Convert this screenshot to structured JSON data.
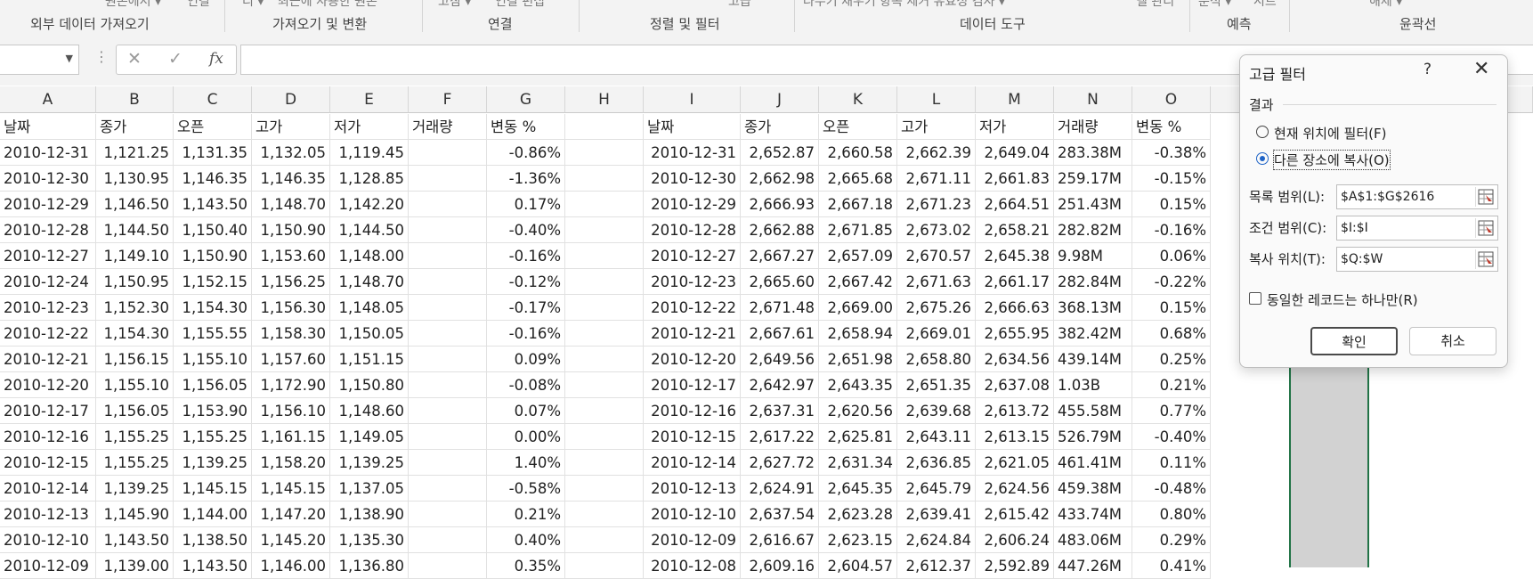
{
  "ribbon": {
    "top_fragments": [
      "원본에서 ▾",
      "연결",
      "리 ▾",
      "최근에 사용한 원본",
      "고침 ▾",
      "연결 편집",
      "고급",
      "나누기 채우기 항목 제거 유효성 검사 ▾",
      "델 관리",
      "분석 ▾",
      "시트",
      "해제 ▾"
    ],
    "groups": [
      "외부 데이터 가져오기",
      "가져오기 및 변환",
      "연결",
      "정렬 및 필터",
      "데이터 도구",
      "예측",
      "윤곽선"
    ]
  },
  "formula_bar": {
    "name_box": "",
    "cancel_icon": "✕",
    "enter_icon": "✓",
    "fx_label": "fx",
    "formula": ""
  },
  "grid": {
    "columns": [
      "A",
      "B",
      "C",
      "D",
      "E",
      "F",
      "G",
      "H",
      "I",
      "J",
      "K",
      "L",
      "M",
      "N",
      "O"
    ],
    "header_row": [
      "날짜",
      "종가",
      "오픈",
      "고가",
      "저가",
      "거래량",
      "변동 %",
      "",
      "날짜",
      "종가",
      "오픈",
      "고가",
      "저가",
      "거래량",
      "변동 %"
    ],
    "rows": [
      [
        "2010-12-31",
        "1,121.25",
        "1,131.35",
        "1,132.05",
        "1,119.45",
        "",
        "-0.86%",
        "",
        "2010-12-31",
        "2,652.87",
        "2,660.58",
        "2,662.39",
        "2,649.04",
        "283.38M",
        "-0.38%"
      ],
      [
        "2010-12-30",
        "1,130.95",
        "1,146.35",
        "1,146.35",
        "1,128.85",
        "",
        "-1.36%",
        "",
        "2010-12-30",
        "2,662.98",
        "2,665.68",
        "2,671.11",
        "2,661.83",
        "259.17M",
        "-0.15%"
      ],
      [
        "2010-12-29",
        "1,146.50",
        "1,143.50",
        "1,148.70",
        "1,142.20",
        "",
        "0.17%",
        "",
        "2010-12-29",
        "2,666.93",
        "2,667.18",
        "2,671.23",
        "2,664.51",
        "251.43M",
        "0.15%"
      ],
      [
        "2010-12-28",
        "1,144.50",
        "1,150.40",
        "1,150.90",
        "1,144.50",
        "",
        "-0.40%",
        "",
        "2010-12-28",
        "2,662.88",
        "2,671.85",
        "2,673.02",
        "2,658.21",
        "282.82M",
        "-0.16%"
      ],
      [
        "2010-12-27",
        "1,149.10",
        "1,150.90",
        "1,153.60",
        "1,148.00",
        "",
        "-0.16%",
        "",
        "2010-12-27",
        "2,667.27",
        "2,657.09",
        "2,670.57",
        "2,645.38",
        "9.98M",
        "0.06%"
      ],
      [
        "2010-12-24",
        "1,150.95",
        "1,152.15",
        "1,156.25",
        "1,148.70",
        "",
        "-0.12%",
        "",
        "2010-12-23",
        "2,665.60",
        "2,667.42",
        "2,671.63",
        "2,661.17",
        "282.84M",
        "-0.22%"
      ],
      [
        "2010-12-23",
        "1,152.30",
        "1,154.30",
        "1,156.30",
        "1,148.05",
        "",
        "-0.17%",
        "",
        "2010-12-22",
        "2,671.48",
        "2,669.00",
        "2,675.26",
        "2,666.63",
        "368.13M",
        "0.15%"
      ],
      [
        "2010-12-22",
        "1,154.30",
        "1,155.55",
        "1,158.30",
        "1,150.05",
        "",
        "-0.16%",
        "",
        "2010-12-21",
        "2,667.61",
        "2,658.94",
        "2,669.01",
        "2,655.95",
        "382.42M",
        "0.68%"
      ],
      [
        "2010-12-21",
        "1,156.15",
        "1,155.10",
        "1,157.60",
        "1,151.15",
        "",
        "0.09%",
        "",
        "2010-12-20",
        "2,649.56",
        "2,651.98",
        "2,658.80",
        "2,634.56",
        "439.14M",
        "0.25%"
      ],
      [
        "2010-12-20",
        "1,155.10",
        "1,156.05",
        "1,172.90",
        "1,150.80",
        "",
        "-0.08%",
        "",
        "2010-12-17",
        "2,642.97",
        "2,643.35",
        "2,651.35",
        "2,637.08",
        "1.03B",
        "0.21%"
      ],
      [
        "2010-12-17",
        "1,156.05",
        "1,153.90",
        "1,156.10",
        "1,148.60",
        "",
        "0.07%",
        "",
        "2010-12-16",
        "2,637.31",
        "2,620.56",
        "2,639.68",
        "2,613.72",
        "455.58M",
        "0.77%"
      ],
      [
        "2010-12-16",
        "1,155.25",
        "1,155.25",
        "1,161.15",
        "1,149.05",
        "",
        "0.00%",
        "",
        "2010-12-15",
        "2,617.22",
        "2,625.81",
        "2,643.11",
        "2,613.15",
        "526.79M",
        "-0.40%"
      ],
      [
        "2010-12-15",
        "1,155.25",
        "1,139.25",
        "1,158.20",
        "1,139.25",
        "",
        "1.40%",
        "",
        "2010-12-14",
        "2,627.72",
        "2,631.34",
        "2,636.85",
        "2,621.05",
        "461.41M",
        "0.11%"
      ],
      [
        "2010-12-14",
        "1,139.25",
        "1,145.15",
        "1,145.15",
        "1,137.05",
        "",
        "-0.58%",
        "",
        "2010-12-13",
        "2,624.91",
        "2,645.35",
        "2,645.79",
        "2,624.56",
        "459.38M",
        "-0.48%"
      ],
      [
        "2010-12-13",
        "1,145.90",
        "1,144.00",
        "1,147.20",
        "1,138.90",
        "",
        "0.21%",
        "",
        "2010-12-10",
        "2,637.54",
        "2,623.28",
        "2,639.41",
        "2,615.42",
        "433.74M",
        "0.80%"
      ],
      [
        "2010-12-10",
        "1,143.50",
        "1,138.50",
        "1,145.20",
        "1,135.30",
        "",
        "0.40%",
        "",
        "2010-12-09",
        "2,616.67",
        "2,623.15",
        "2,624.84",
        "2,606.24",
        "483.06M",
        "0.29%"
      ],
      [
        "2010-12-09",
        "1,139.00",
        "1,143.50",
        "1,146.00",
        "1,136.80",
        "",
        "0.35%",
        "",
        "2010-12-08",
        "2,609.16",
        "2,604.57",
        "2,612.37",
        "2,592.89",
        "447.26M",
        "0.41%"
      ]
    ]
  },
  "dialog": {
    "title": "고급 필터",
    "help": "?",
    "close": "✕",
    "section": "결과",
    "radio1": "현재 위치에 필터(F)",
    "radio2": "다른 장소에 복사(O)",
    "list_range_label": "목록 범위(L):",
    "list_range_value": "$A$1:$G$2616",
    "criteria_range_label": "조건 범위(C):",
    "criteria_range_value": "$I:$I",
    "copy_to_label": "복사 위치(T):",
    "copy_to_value": "$Q:$W",
    "unique_label": "동일한 레코드는 하나만(R)",
    "ok": "확인",
    "cancel": "취소",
    "selected_option": "radio2"
  }
}
